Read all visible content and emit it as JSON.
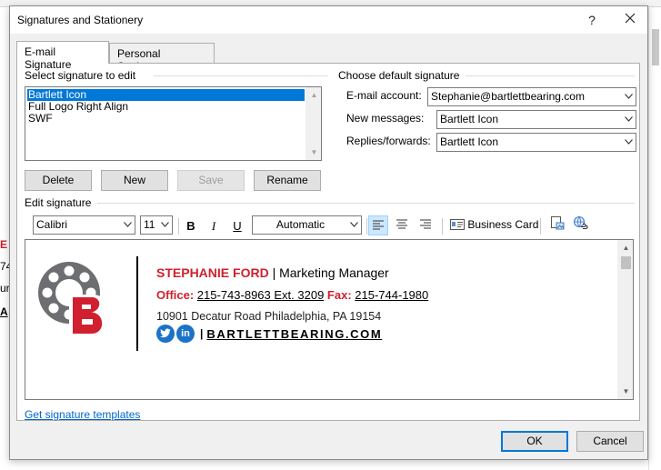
{
  "background": {
    "fragments": [
      "E",
      "74",
      "ur",
      "A"
    ]
  },
  "dialog": {
    "title": "Signatures and Stationery",
    "help": "?",
    "close": "✕"
  },
  "tabs": [
    {
      "label": "E-mail Signature",
      "active": true
    },
    {
      "label": "Personal Stationery",
      "active": false
    }
  ],
  "select_signature": {
    "label": "Select signature to edit",
    "items": [
      "Bartlett Icon",
      "Full Logo Right Align",
      "SWF"
    ],
    "selected_index": 0
  },
  "buttons": {
    "delete": "Delete",
    "new": "New",
    "save": "Save",
    "rename": "Rename",
    "ok": "OK",
    "cancel": "Cancel"
  },
  "default_signature": {
    "label": "Choose default signature",
    "email_account_label": "E-mail account:",
    "email_account_value": "Stephanie@bartlettbearing.com",
    "new_messages_label": "New messages:",
    "new_messages_value": "Bartlett Icon",
    "replies_label": "Replies/forwards:",
    "replies_value": "Bartlett Icon"
  },
  "edit_signature": {
    "label": "Edit signature",
    "font": "Calibri",
    "size": "11",
    "bold": "B",
    "italic": "I",
    "underline": "U",
    "color": "Automatic",
    "business_card": "Business Card"
  },
  "signature": {
    "name": "STEPHANIE FORD",
    "separator": " | ",
    "title": "Marketing Manager",
    "office_label": "Office:",
    "office_phone": "215-743-8963 Ext. 3209",
    "fax_label": "Fax:",
    "fax_phone": "215-744-1980",
    "address": "10901 Decatur Road Philadelphia, PA 19154",
    "website_sep": "|",
    "website": "BARTLETTBEARING.COM"
  },
  "templates_link": "Get signature templates",
  "colors": {
    "accent": "#0078d7",
    "brand_red": "#d0202f",
    "logo_gray": "#6d6e71"
  }
}
